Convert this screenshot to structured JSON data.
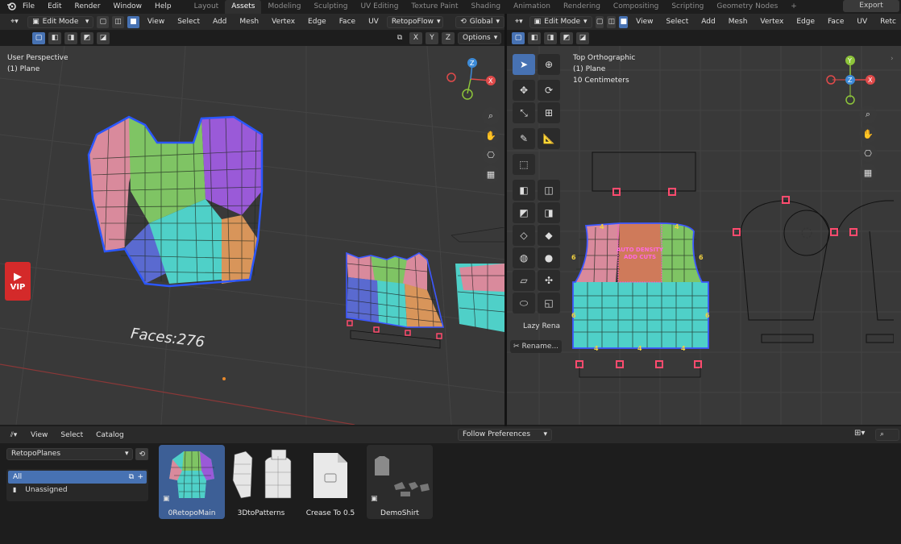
{
  "topbar": {
    "menus": [
      "File",
      "Edit",
      "Render",
      "Window",
      "Help"
    ],
    "workspaces": [
      "Layout",
      "Assets",
      "Modeling",
      "Sculpting",
      "UV Editing",
      "Texture Paint",
      "Shading",
      "Animation",
      "Rendering",
      "Compositing",
      "Scripting",
      "Geometry Nodes"
    ],
    "active_workspace": "Assets",
    "add_tab": "+",
    "export_label": "Export"
  },
  "left_viewport": {
    "mode": "Edit Mode",
    "menus": [
      "View",
      "Select",
      "Add",
      "Mesh",
      "Vertex",
      "Edge",
      "Face",
      "UV"
    ],
    "addon_dropdown": "RetopoFlow",
    "transform_orientation": "Global",
    "mirror_axes": [
      "X",
      "Y",
      "Z"
    ],
    "options_label": "Options",
    "perspective_label": "User Perspective",
    "object_label": "(1) Plane",
    "faces_text": "Faces:276",
    "vip_label": "VIP",
    "accent": "#4772b3"
  },
  "right_viewport": {
    "mode": "Edit Mode",
    "menus": [
      "View",
      "Select",
      "Add",
      "Mesh",
      "Vertex",
      "Edge",
      "Face",
      "UV",
      "Retc"
    ],
    "view_label": "Top Orthographic",
    "object_label": "(1) Plane",
    "scale_label": "10 Centimeters",
    "mesh_overlay_text_1": "AUTO DENSITY",
    "mesh_overlay_text_2": "ADD CUTS",
    "lazy_label": "Lazy Rena",
    "rename_label": "Rename...",
    "edge_counts": [
      "4",
      "6",
      "6",
      "4",
      "4",
      "6",
      "6",
      "4",
      "4",
      "4"
    ]
  },
  "gizmo": {
    "x": "X",
    "y": "Y",
    "z": "Z",
    "x_color": "#e04a4a",
    "y_color": "#8dc43a",
    "z_color": "#3d8bd8"
  },
  "asset_browser": {
    "menus": [
      "View",
      "Select",
      "Catalog"
    ],
    "library": "RetopoPlanes",
    "filter_label": "Follow Preferences",
    "catalogs": [
      "All",
      "Unassigned"
    ],
    "assets": [
      "0RetopoMain",
      "3DtoPatterns",
      "Crease To 0.5",
      "DemoShirt"
    ]
  }
}
